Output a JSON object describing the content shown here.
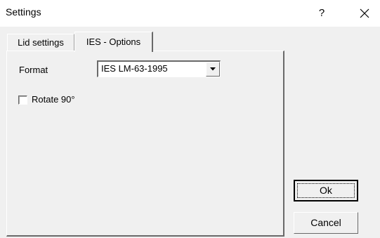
{
  "window": {
    "title": "Settings",
    "help_label": "?",
    "close_icon": "close-icon"
  },
  "tabs": [
    {
      "label": "Lid settings",
      "selected": false
    },
    {
      "label": "IES - Options",
      "selected": true
    }
  ],
  "ies_options": {
    "format_label": "Format",
    "format_value": "IES LM-63-1995",
    "rotate_label": "Rotate 90°",
    "rotate_checked": false
  },
  "buttons": {
    "ok_label": "Ok",
    "cancel_label": "Cancel"
  }
}
